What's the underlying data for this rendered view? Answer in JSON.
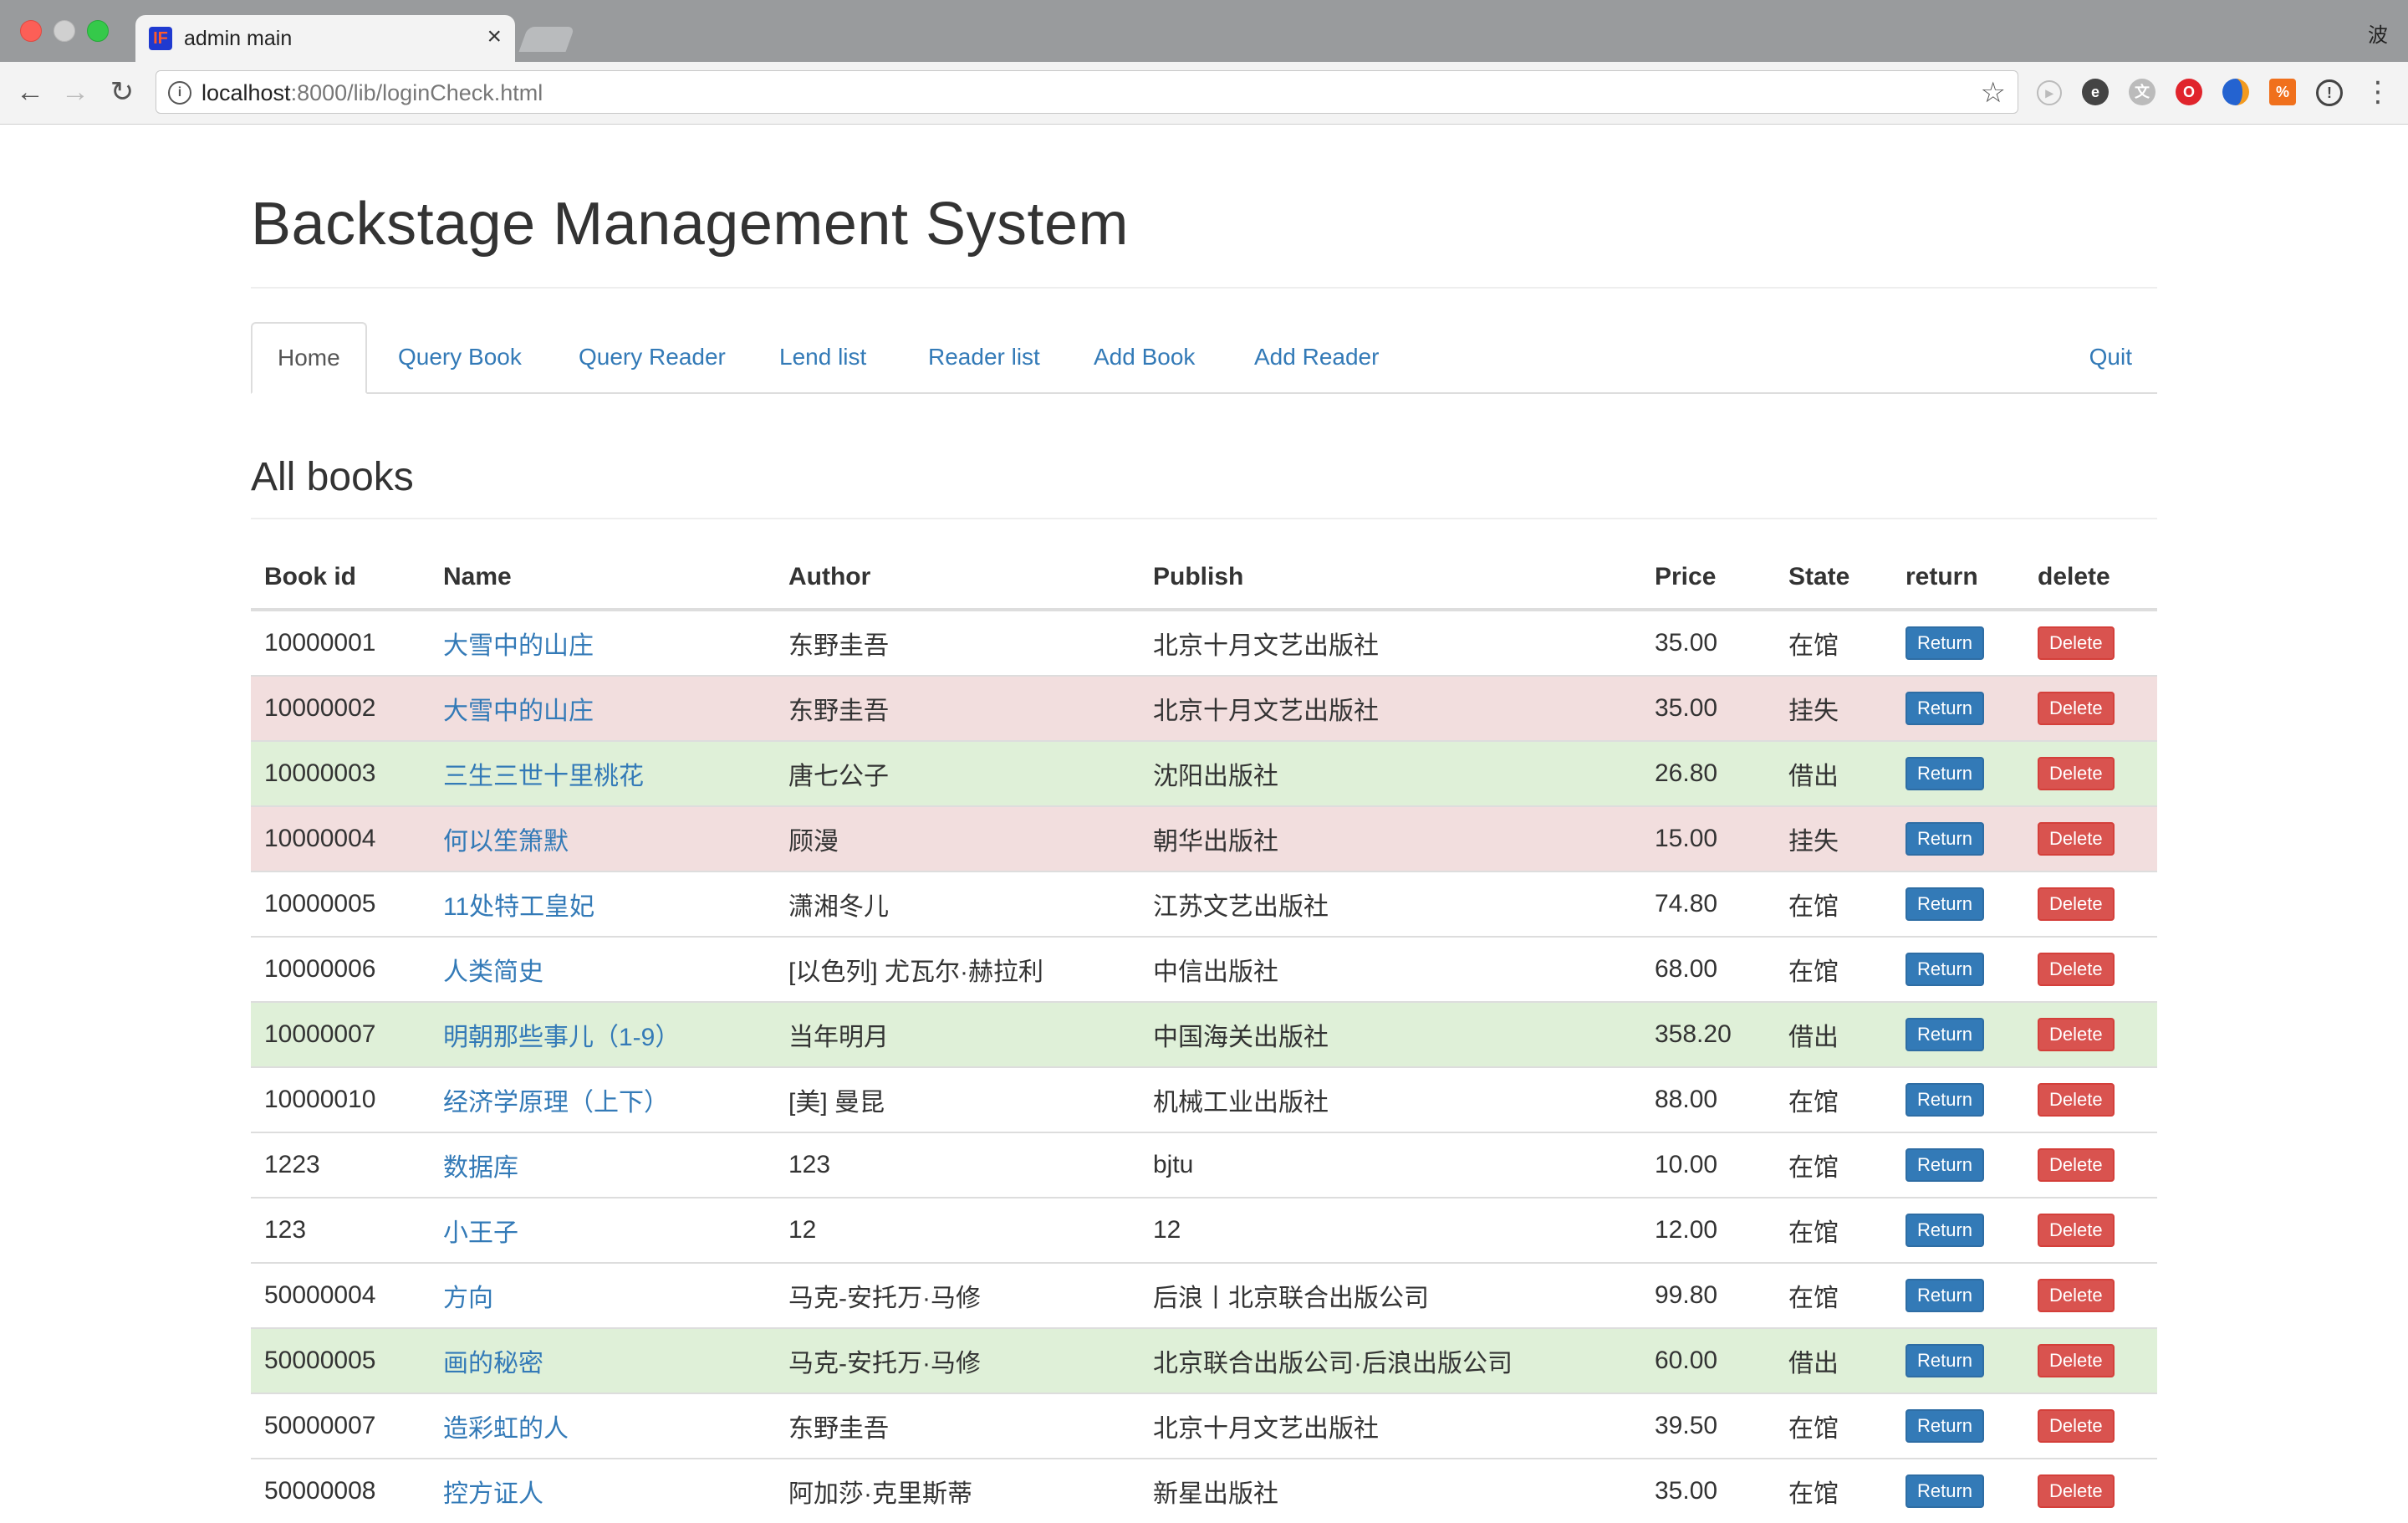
{
  "browser": {
    "tab_title": "admin main",
    "tab_close": "×",
    "favicon_glyph": "IF",
    "user_glyph": "波",
    "url_host": "localhost",
    "url_path": ":8000/lib/loginCheck.html",
    "back_glyph": "←",
    "forward_glyph": "→",
    "reload_glyph": "↻",
    "star_glyph": "☆",
    "menu_glyph": "⋮",
    "extensions": [
      "play-icon",
      "evernote-icon",
      "translate-icon",
      "opera-icon",
      "blue-orange-icon",
      "translator-icon",
      "info-icon"
    ]
  },
  "page": {
    "title": "Backstage Management System",
    "nav": {
      "home": "Home",
      "query_book": "Query Book",
      "query_reader": "Query Reader",
      "lend_list": "Lend list",
      "reader_list": "Reader list",
      "add_book": "Add Book",
      "add_reader": "Add Reader",
      "quit": "Quit"
    },
    "section_title": "All books",
    "table": {
      "headers": {
        "book_id": "Book id",
        "name": "Name",
        "author": "Author",
        "publish": "Publish",
        "price": "Price",
        "state": "State",
        "return": "return",
        "delete": "delete"
      },
      "return_label": "Return",
      "delete_label": "Delete",
      "rows": [
        {
          "id": "10000001",
          "name": "大雪中的山庄",
          "author": "东野圭吾",
          "publish": "北京十月文艺出版社",
          "price": "35.00",
          "state": "在馆",
          "status": ""
        },
        {
          "id": "10000002",
          "name": "大雪中的山庄",
          "author": "东野圭吾",
          "publish": "北京十月文艺出版社",
          "price": "35.00",
          "state": "挂失",
          "status": "danger"
        },
        {
          "id": "10000003",
          "name": "三生三世十里桃花",
          "author": "唐七公子",
          "publish": "沈阳出版社",
          "price": "26.80",
          "state": "借出",
          "status": "success"
        },
        {
          "id": "10000004",
          "name": "何以笙箫默",
          "author": "顾漫",
          "publish": "朝华出版社",
          "price": "15.00",
          "state": "挂失",
          "status": "danger"
        },
        {
          "id": "10000005",
          "name": "11处特工皇妃",
          "author": "潇湘冬儿",
          "publish": "江苏文艺出版社",
          "price": "74.80",
          "state": "在馆",
          "status": ""
        },
        {
          "id": "10000006",
          "name": "人类简史",
          "author": "[以色列] 尤瓦尔·赫拉利",
          "publish": "中信出版社",
          "price": "68.00",
          "state": "在馆",
          "status": ""
        },
        {
          "id": "10000007",
          "name": "明朝那些事儿（1-9）",
          "author": "当年明月",
          "publish": "中国海关出版社",
          "price": "358.20",
          "state": "借出",
          "status": "success"
        },
        {
          "id": "10000010",
          "name": "经济学原理（上下）",
          "author": "[美] 曼昆",
          "publish": "机械工业出版社",
          "price": "88.00",
          "state": "在馆",
          "status": ""
        },
        {
          "id": "1223",
          "name": "数据库",
          "author": "123",
          "publish": "bjtu",
          "price": "10.00",
          "state": "在馆",
          "status": ""
        },
        {
          "id": "123",
          "name": "小王子",
          "author": "12",
          "publish": "12",
          "price": "12.00",
          "state": "在馆",
          "status": ""
        },
        {
          "id": "50000004",
          "name": "方向",
          "author": "马克-安托万·马修",
          "publish": "后浪丨北京联合出版公司",
          "price": "99.80",
          "state": "在馆",
          "status": ""
        },
        {
          "id": "50000005",
          "name": "画的秘密",
          "author": "马克-安托万·马修",
          "publish": "北京联合出版公司·后浪出版公司",
          "price": "60.00",
          "state": "借出",
          "status": "success"
        },
        {
          "id": "50000007",
          "name": "造彩虹的人",
          "author": "东野圭吾",
          "publish": "北京十月文艺出版社",
          "price": "39.50",
          "state": "在馆",
          "status": ""
        },
        {
          "id": "50000008",
          "name": "控方证人",
          "author": "阿加莎·克里斯蒂",
          "publish": "新星出版社",
          "price": "35.00",
          "state": "在馆",
          "status": ""
        }
      ]
    }
  },
  "colors": {
    "link": "#337ab7",
    "danger_row": "#f2dede",
    "success_row": "#dff0d8",
    "btn_primary": "#337ab7",
    "btn_danger": "#d9534f"
  }
}
